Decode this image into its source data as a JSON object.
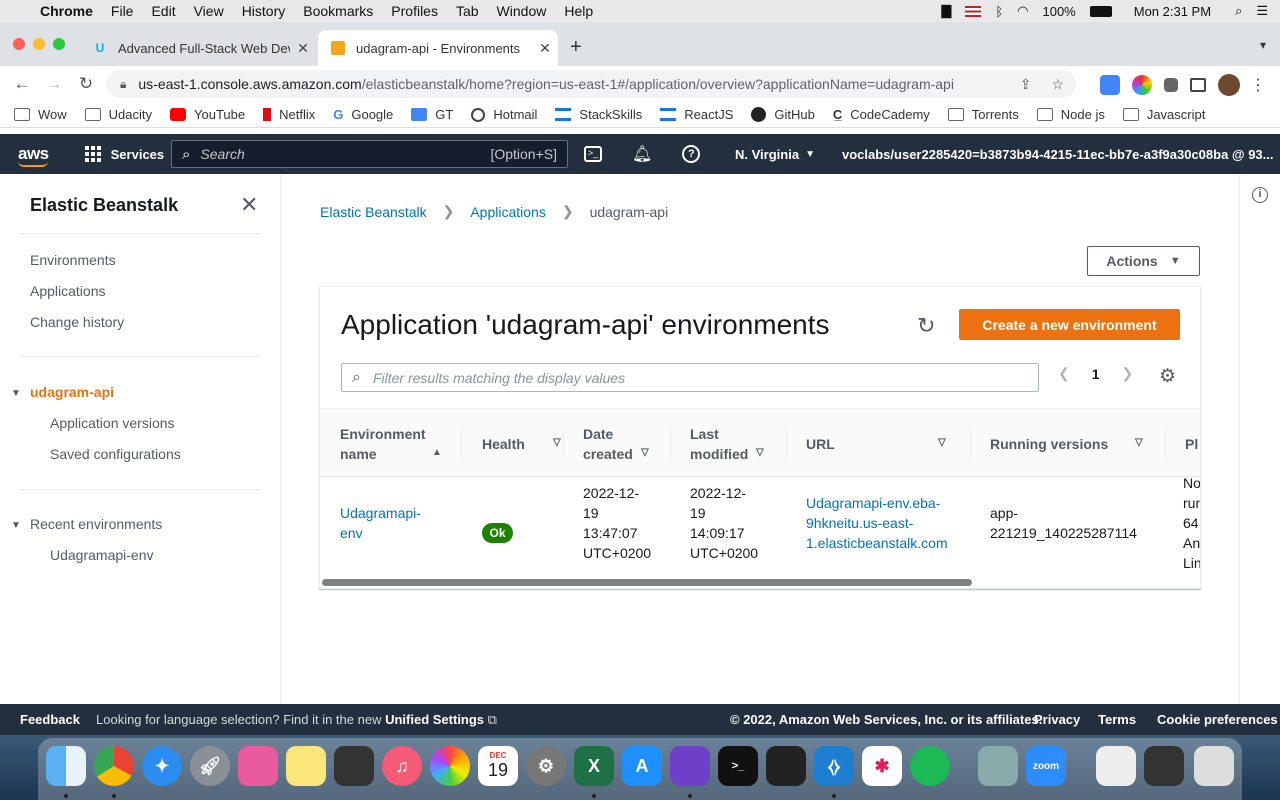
{
  "menubar": {
    "app": "Chrome",
    "items": [
      "File",
      "Edit",
      "View",
      "History",
      "Bookmarks",
      "Profiles",
      "Tab",
      "Window",
      "Help"
    ],
    "battery": "100%",
    "clock": "Mon 2:31 PM"
  },
  "browser": {
    "tabs": [
      {
        "title": "Advanced Full-Stack Web Deve"
      },
      {
        "title": "udagram-api - Environments"
      }
    ],
    "url_host": "us-east-1.console.aws.amazon.com",
    "url_rest": "/elasticbeanstalk/home?region=us-east-1#/application/overview?applicationName=udagram-api",
    "bookmarks": [
      "Wow",
      "Udacity",
      "YouTube",
      "Netflix",
      "Google",
      "GT",
      "Hotmail",
      "StackSkills",
      "ReactJS",
      "GitHub",
      "CodeCademy",
      "Torrents",
      "Node js",
      "Javascript"
    ]
  },
  "aws_nav": {
    "logo": "aws",
    "services": "Services",
    "search_placeholder": "Search",
    "search_shortcut": "[Option+S]",
    "region": "N. Virginia",
    "user": "voclabs/user2285420=b3873b94-4215-11ec-bb7e-a3f9a30c08ba @ 93..."
  },
  "sidebar": {
    "title": "Elastic Beanstalk",
    "items": [
      "Environments",
      "Applications",
      "Change history"
    ],
    "app_name": "udagram-api",
    "app_items": [
      "Application versions",
      "Saved configurations"
    ],
    "recent_label": "Recent environments",
    "recent_items": [
      "Udagramapi-env"
    ]
  },
  "breadcrumb": [
    "Elastic Beanstalk",
    "Applications",
    "udagram-api"
  ],
  "actions_label": "Actions",
  "panel": {
    "title": "Application 'udagram-api' environments",
    "create_label": "Create a new environment",
    "filter_placeholder": "Filter results matching the display values",
    "page": "1"
  },
  "table": {
    "columns": [
      {
        "line1": "Environment",
        "line2": "name"
      },
      {
        "line1": "Health",
        "line2": ""
      },
      {
        "line1": "Date",
        "line2": "created"
      },
      {
        "line1": "Last",
        "line2": "modified"
      },
      {
        "line1": "URL",
        "line2": ""
      },
      {
        "line1": "Running versions",
        "line2": ""
      },
      {
        "line1": "Pl",
        "line2": ""
      }
    ],
    "row": {
      "env_name": [
        "Udagramapi-",
        "env"
      ],
      "health": "Ok",
      "date_created": [
        "2022-12-",
        "19",
        "13:47:07",
        "UTC+0200"
      ],
      "last_modified": [
        "2022-12-",
        "19",
        "14:09:17",
        "UTC+0200"
      ],
      "url": [
        "Udagramapi-env.eba-",
        "9hkneitu.us-east-",
        "1.elasticbeanstalk.com"
      ],
      "running_versions": [
        "app-",
        "221219_140225287114"
      ],
      "platform": [
        "No",
        "run",
        "64",
        "An",
        "Lin"
      ]
    }
  },
  "footer": {
    "feedback": "Feedback",
    "lang_text": "Looking for language selection? Find it in the new",
    "lang_link": "Unified Settings",
    "copyright": "© 2022, Amazon Web Services, Inc. or its affiliates.",
    "links": [
      "Privacy",
      "Terms",
      "Cookie preferences"
    ]
  },
  "dock": {
    "calendar_month": "DEC",
    "calendar_day": "19",
    "zoom_label": "zoom"
  }
}
